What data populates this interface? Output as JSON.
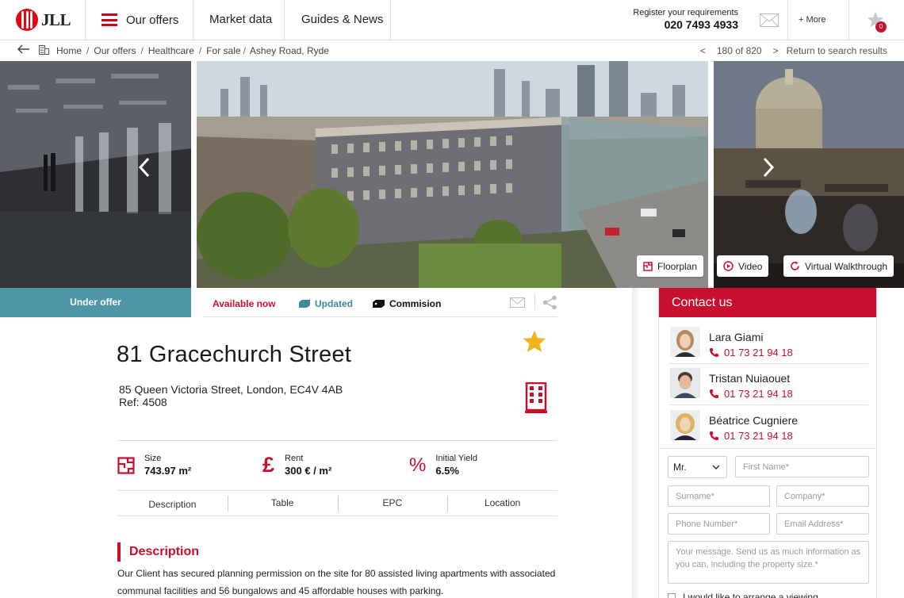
{
  "header": {
    "logo_text": "JLL",
    "nav": [
      "Our offers",
      "Market data",
      "Guides & News"
    ],
    "register_label": "Register your requirements",
    "register_phone": "020 7493 4933",
    "more_label": "+ More",
    "favorites_count": "0"
  },
  "breadcrumb": {
    "items": [
      "Home",
      "Our offers",
      "Healthcare",
      "For sale",
      "Ashey Road, Ryde"
    ],
    "separator": "/",
    "position": "180 of 820",
    "prev_symbol": "<",
    "next_symbol": ">",
    "return_label": "Return to search results"
  },
  "gallery": {
    "buttons": [
      "Floorplan",
      "Video",
      "Virtual Walkthrough"
    ]
  },
  "status": {
    "under_offer": "Under offer",
    "available": "Available now",
    "updated": "Updated",
    "commission": "Commision"
  },
  "property": {
    "title": "81 Gracechurch Street",
    "address": "85 Queen Victoria Street, London, EC4V 4AB",
    "ref": "Ref: 4508",
    "facts": [
      {
        "label": "Size",
        "value": "743.97 m²",
        "icon": "floorplan-icon"
      },
      {
        "label": "Rent",
        "value": "300 € / m²",
        "icon": "pound-icon"
      },
      {
        "label": "Initial Yield",
        "value": "6.5%",
        "icon": "percent-icon"
      }
    ],
    "tabs": [
      "Description",
      "Table",
      "EPC",
      "Location"
    ],
    "description_heading": "Description",
    "description_text": "Our Client has secured planning permission on the site for 80 assisted living apartments with associated communal facilities and 56 bungalows and 45 affordable houses with parking."
  },
  "contact": {
    "heading": "Contact us",
    "agents": [
      {
        "name": "Lara Giami",
        "phone": "01 73 21 94 18"
      },
      {
        "name": "Tristan Nuiaouet",
        "phone": "01 73 21 94 18"
      },
      {
        "name": "Béatrice Cugniere",
        "phone": "01 73 21 94 18"
      }
    ],
    "form": {
      "title_value": "Mr.",
      "first_name": "First Name*",
      "surname": "Surname*",
      "company": "Company*",
      "phone": "Phone Number*",
      "email": "Email Address*",
      "message": "Your message. Send us as much information as you can, including the property size.*",
      "viewing_label": "I would like to arrange a viewing"
    }
  },
  "colors": {
    "brand_red": "#c8102e",
    "under_offer_teal": "#4f97a6",
    "updated_teal": "#3e8a98",
    "star_gold": "#f0b41c"
  }
}
